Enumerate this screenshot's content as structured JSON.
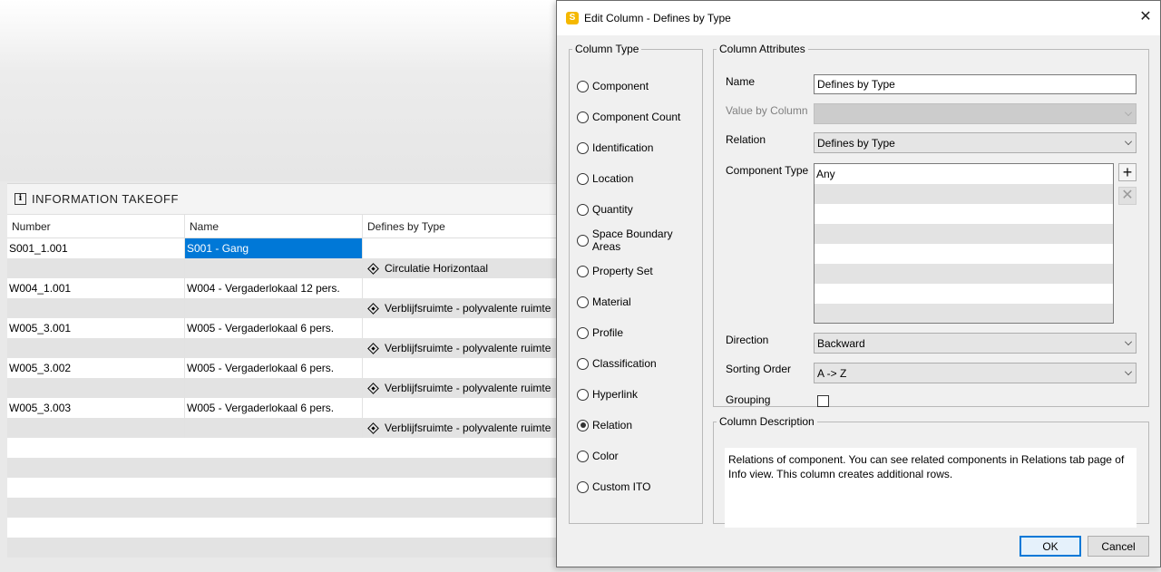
{
  "takeoff": {
    "title": "INFORMATION TAKEOFF",
    "columns": [
      "Number",
      "Name",
      "Defines by Type"
    ],
    "rows": [
      [
        "S001_1.001",
        "S001 - Gang",
        ""
      ],
      [
        "",
        "",
        "Circulatie Horizontaal"
      ],
      [
        "W004_1.001",
        "W004 - Vergaderlokaal 12 pers.",
        ""
      ],
      [
        "",
        "",
        "Verblijfsruimte - polyvalente ruimte"
      ],
      [
        "W005_3.001",
        "W005 - Vergaderlokaal 6 pers.",
        ""
      ],
      [
        "",
        "",
        "Verblijfsruimte - polyvalente ruimte"
      ],
      [
        "W005_3.002",
        "W005 - Vergaderlokaal 6 pers.",
        ""
      ],
      [
        "",
        "",
        "Verblijfsruimte - polyvalente ruimte"
      ],
      [
        "W005_3.003",
        "W005 - Vergaderlokaal 6 pers.",
        ""
      ],
      [
        "",
        "",
        "Verblijfsruimte - polyvalente ruimte"
      ]
    ]
  },
  "dialog": {
    "title": "Edit Column - Defines by Type",
    "app_icon_letter": "S",
    "column_type": {
      "legend": "Column Type",
      "options": [
        "Component",
        "Component Count",
        "Identification",
        "Location",
        "Quantity",
        "Space Boundary Areas",
        "Property Set",
        "Material",
        "Profile",
        "Classification",
        "Hyperlink",
        "Relation",
        "Color",
        "Custom ITO"
      ],
      "selected": "Relation"
    },
    "attributes": {
      "legend": "Column Attributes",
      "name_label": "Name",
      "name_value": "Defines by Type",
      "value_by_column_label": "Value by Column",
      "value_by_column_value": "",
      "relation_label": "Relation",
      "relation_value": "Defines by Type",
      "component_type_label": "Component Type",
      "component_types": [
        "Any"
      ],
      "direction_label": "Direction",
      "direction_value": "Backward",
      "sorting_label": "Sorting Order",
      "sorting_value": "A -> Z",
      "grouping_label": "Grouping",
      "grouping_checked": false
    },
    "description": {
      "legend": "Column Description",
      "text": "Relations of component. You can see related components in Relations tab page of Info view. This column creates additional rows."
    },
    "ok_label": "OK",
    "cancel_label": "Cancel",
    "colors": {
      "accent": "#0078d7",
      "app_icon": "#f5b800"
    }
  }
}
